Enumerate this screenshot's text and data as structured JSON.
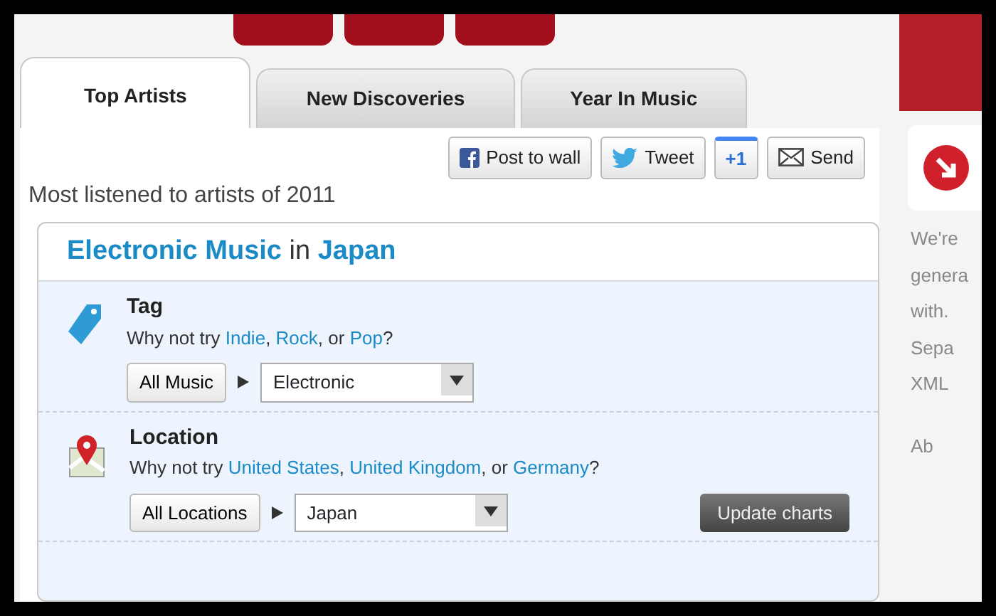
{
  "tabs": [
    {
      "label": "Top Artists",
      "selected": true
    },
    {
      "label": "New Discoveries",
      "selected": false
    },
    {
      "label": "Year In Music",
      "selected": false
    }
  ],
  "share_buttons": [
    {
      "kind": "facebook",
      "label": "Post to wall"
    },
    {
      "kind": "twitter",
      "label": "Tweet"
    },
    {
      "kind": "plusone",
      "label": "+1"
    },
    {
      "kind": "email",
      "label": "Send"
    }
  ],
  "subtitle": "Most listened to artists of 2011",
  "heading": [
    {
      "link": "Electronic Music"
    },
    {
      "text": " in "
    },
    {
      "link": "Japan"
    }
  ],
  "filters": [
    {
      "kind": "tag",
      "title": "Tag",
      "hint": [
        {
          "text": "Why not try "
        },
        {
          "link": "Indie"
        },
        {
          "text": ", "
        },
        {
          "link": "Rock"
        },
        {
          "text": ", or "
        },
        {
          "link": "Pop"
        },
        {
          "text": "?"
        }
      ],
      "reset": "All Music",
      "value": "Electronic"
    },
    {
      "kind": "location",
      "title": "Location",
      "hint": [
        {
          "text": "Why not try "
        },
        {
          "link": "United States"
        },
        {
          "text": ", "
        },
        {
          "link": "United Kingdom"
        },
        {
          "text": ", or "
        },
        {
          "link": "Germany"
        },
        {
          "text": "?"
        }
      ],
      "reset": "All Locations",
      "value": "Japan"
    }
  ],
  "update_button": "Update charts",
  "sidebar": {
    "lines": [
      "We're",
      "genera",
      "with."
    ],
    "links": [
      "Sepa",
      "XML"
    ],
    "bottom_link": "Ab"
  }
}
